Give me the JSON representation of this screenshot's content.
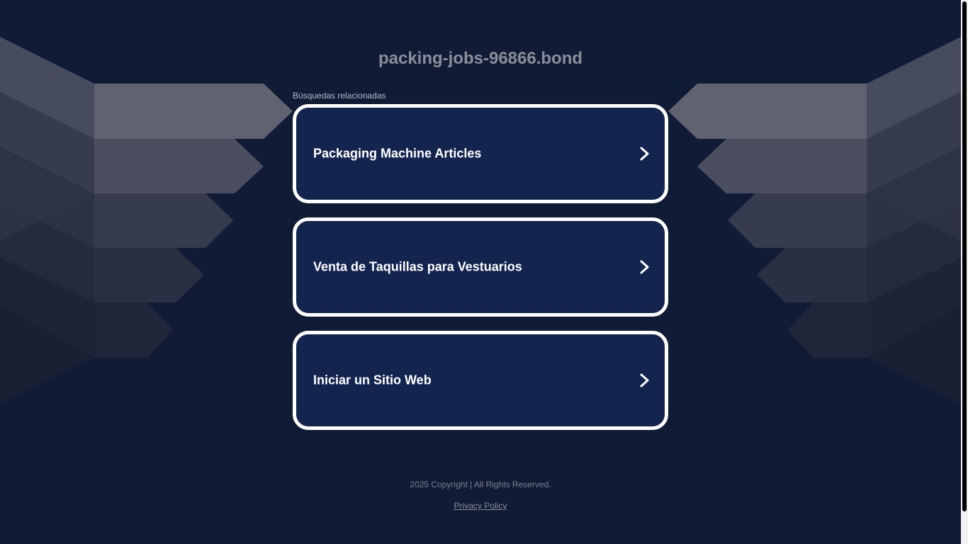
{
  "header": {
    "domain": "packing-jobs-96866.bond"
  },
  "related": {
    "label": "Búsquedas relacionadas",
    "links": [
      {
        "label": "Packaging Machine Articles"
      },
      {
        "label": "Venta de Taquillas para Vestuarios"
      },
      {
        "label": "Iniciar un Sitio Web"
      }
    ]
  },
  "footer": {
    "copyright": "2025 Copyright | All Rights Reserved.",
    "privacy_label": "Privacy Policy"
  },
  "colors": {
    "background": "#101c36",
    "card_fill": "#13244f",
    "card_border": "#ffffff"
  },
  "icons": {
    "card_arrow": "chevron-right-icon"
  }
}
